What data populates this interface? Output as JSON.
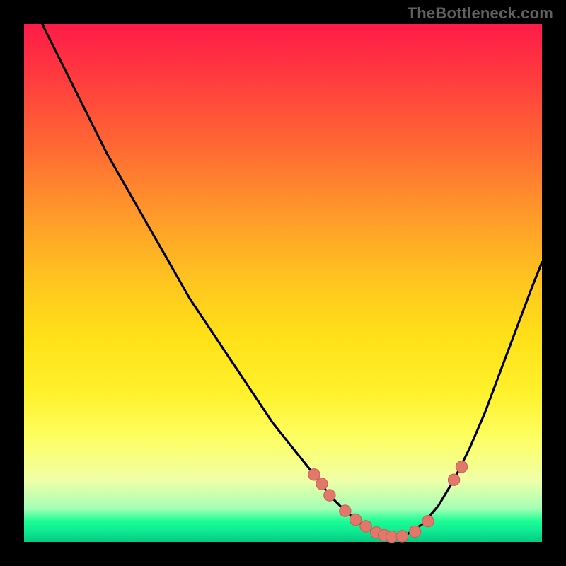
{
  "watermark": "TheBottleneck.com",
  "colors": {
    "background": "#000000",
    "curve": "#000000",
    "marker_fill": "#e2786c",
    "marker_stroke": "#c95c51"
  },
  "chart_data": {
    "type": "line",
    "title": "",
    "xlabel": "",
    "ylabel": "",
    "xlim": [
      0,
      100
    ],
    "ylim": [
      0,
      100
    ],
    "grid": false,
    "series": [
      {
        "name": "bottleneck-curve",
        "x": [
          0,
          4,
          8,
          12,
          16,
          20,
          24,
          28,
          32,
          36,
          40,
          44,
          48,
          52,
          56,
          59,
          62,
          65,
          68,
          71,
          74,
          77,
          80,
          83,
          86,
          89,
          92,
          95,
          98,
          100
        ],
        "y": [
          108,
          99,
          91,
          83,
          75,
          68,
          61,
          54,
          47,
          41,
          35,
          29,
          23,
          18,
          13,
          9,
          6,
          3.5,
          1.8,
          1.0,
          1.5,
          3.5,
          7,
          12,
          18,
          25,
          33,
          41,
          49,
          54
        ]
      }
    ],
    "markers": {
      "name": "highlight-points",
      "x": [
        56,
        57.5,
        59,
        62,
        64,
        66,
        68,
        69.5,
        71,
        73,
        75.5,
        78,
        83,
        84.5
      ],
      "y": [
        13,
        11.2,
        9,
        6,
        4.3,
        3,
        1.8,
        1.3,
        1.0,
        1.1,
        2.0,
        4.0,
        12,
        14.5
      ]
    }
  }
}
